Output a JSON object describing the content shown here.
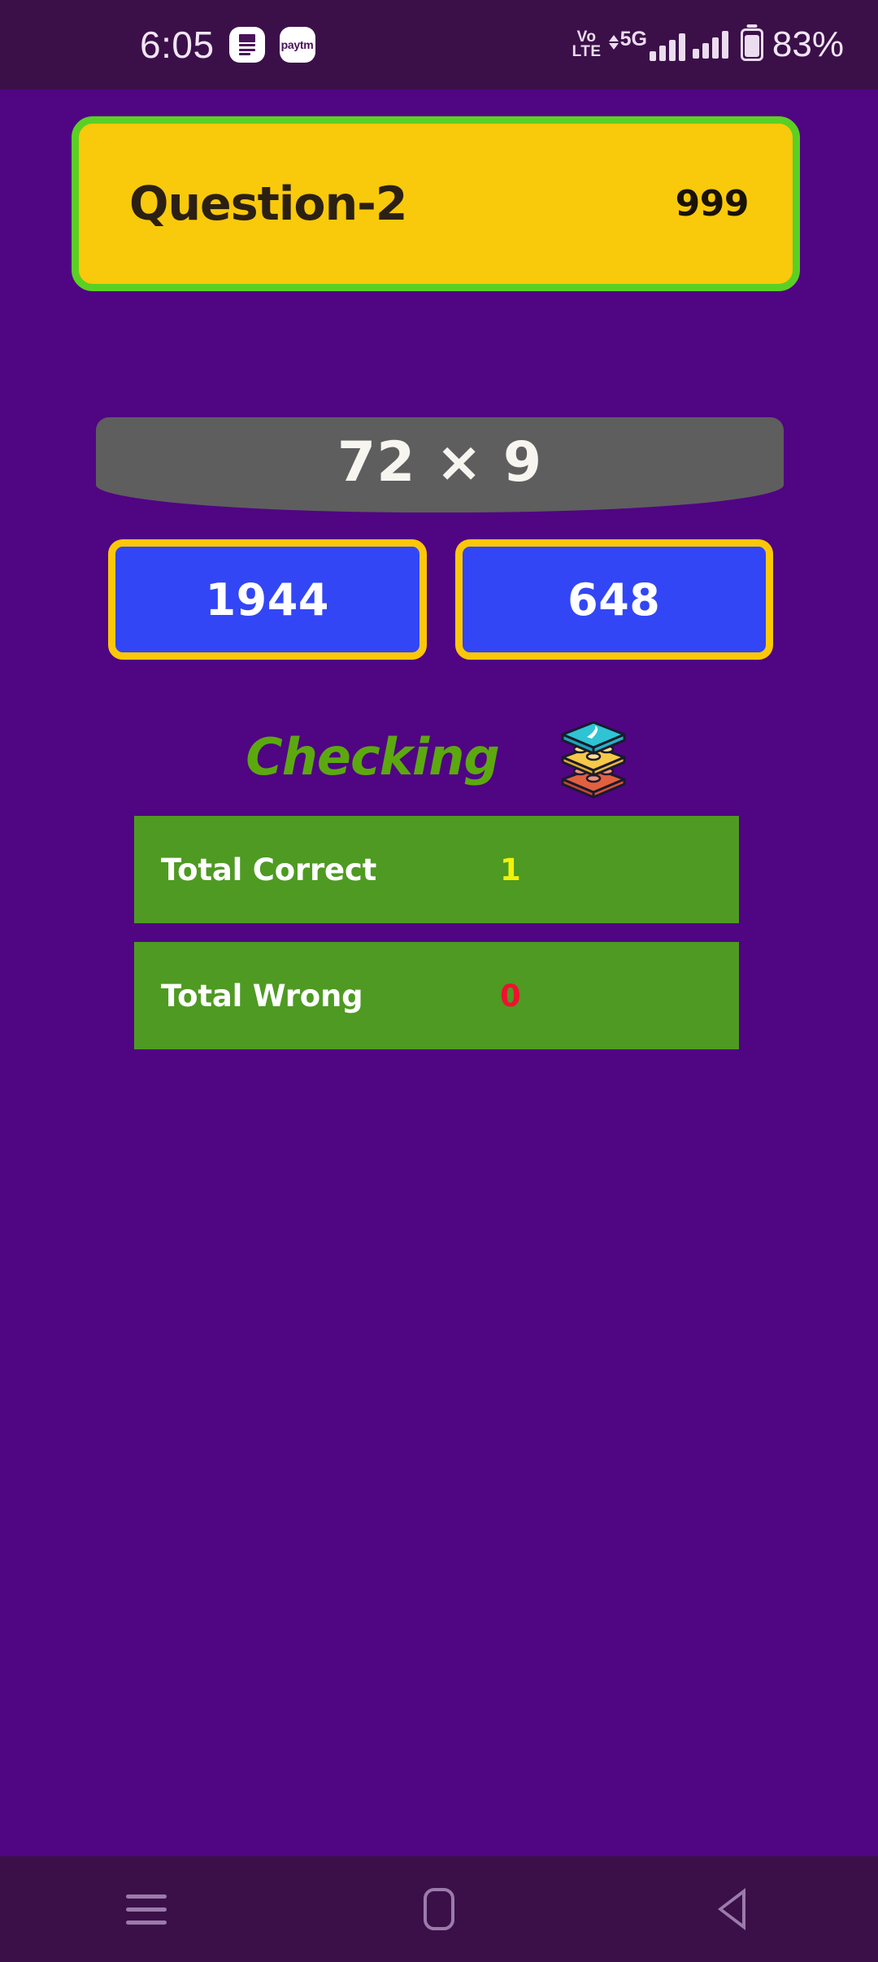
{
  "status_bar": {
    "clock": "6:05",
    "notification_icons": [
      {
        "name": "note-app-icon",
        "label": ""
      },
      {
        "name": "paytm-icon",
        "label": "paytm"
      }
    ],
    "volte_top": "Vo",
    "volte_bottom": "LTE",
    "network_type": "5G",
    "battery_percent": "83%",
    "background_color": "#3B1049",
    "text_color": "#F2E6F5"
  },
  "question_header": {
    "title": "Question-2",
    "counter": "999",
    "fill_color": "#F9C90B",
    "border_color": "#5BD024",
    "text_color": "#2B2013"
  },
  "expression": {
    "text": "72 × 9",
    "operand_left": "72",
    "operator": "×",
    "operand_right": "9",
    "panel_color": "#5E5E5E",
    "text_color": "#F7F5F0"
  },
  "answers": {
    "options": [
      {
        "label": "1944"
      },
      {
        "label": "648"
      }
    ],
    "fill_color": "#3246F5",
    "border_color": "#FCC707",
    "text_color": "#FFFFFF"
  },
  "feedback": {
    "status_text": "Checking",
    "status_color": "#5CA90F",
    "icon_name": "stacked-bricks-icon"
  },
  "score": {
    "rows": [
      {
        "label": "Total Correct",
        "value": "1",
        "value_color": "#F2F20A"
      },
      {
        "label": "Total Wrong",
        "value": "0",
        "value_color": "#F01030"
      }
    ],
    "bar_color": "#4E9A22",
    "label_color": "#FFFFFF"
  },
  "nav_bar": {
    "recent_label": "Recent apps",
    "home_label": "Home",
    "back_label": "Back",
    "icon_color": "#9B7BAA",
    "background_color": "#3B1049"
  },
  "theme": {
    "page_background": "#500583"
  }
}
